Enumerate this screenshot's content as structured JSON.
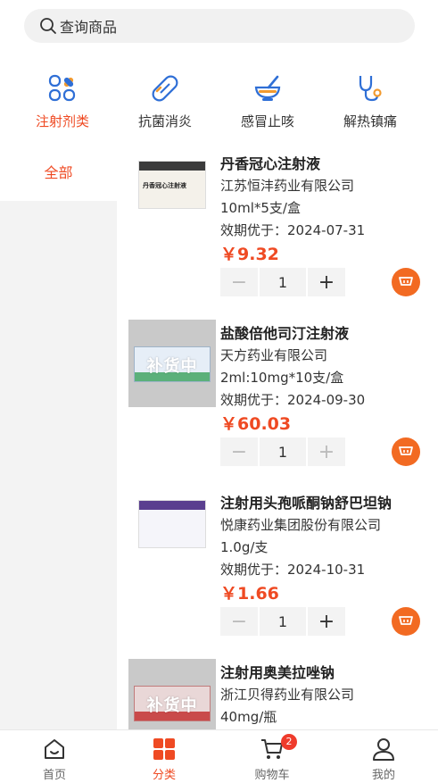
{
  "search": {
    "placeholder": "查询商品"
  },
  "categories": [
    {
      "label": "注射剂类",
      "icon": "vials-grid-icon",
      "active": true
    },
    {
      "label": "抗菌消炎",
      "icon": "capsule-icon",
      "active": false
    },
    {
      "label": "感冒止咳",
      "icon": "mortar-pestle-icon",
      "active": false
    },
    {
      "label": "解热镇痛",
      "icon": "stethoscope-icon",
      "active": false
    }
  ],
  "side_menu": {
    "items": [
      {
        "label": "全部",
        "active": true
      }
    ]
  },
  "products": [
    {
      "name": "丹香冠心注射液",
      "maker": "江苏恒沣药业有限公司",
      "spec": "10ml*5支/盒",
      "expiry": "效期优于：2024-07-31",
      "price": "￥9.32",
      "qty": "1",
      "restock": false,
      "restock_label": "",
      "box_text": "丹香冠心注射液"
    },
    {
      "name": "盐酸倍他司汀注射液",
      "maker": "天方药业有限公司",
      "spec": "2ml:10mg*10支/盒",
      "expiry": "效期优于：2024-09-30",
      "price": "￥60.03",
      "qty": "1",
      "restock": true,
      "restock_label": "补货中"
    },
    {
      "name": "注射用头孢哌酮钠舒巴坦钠",
      "maker": "悦康药业集团股份有限公司",
      "spec": "1.0g/支",
      "expiry": "效期优于：2024-10-31",
      "price": "￥1.66",
      "qty": "1",
      "restock": false,
      "restock_label": ""
    },
    {
      "name": "注射用奥美拉唑钠",
      "maker": "浙江贝得药业有限公司",
      "spec": "40mg/瓶",
      "restock": true,
      "restock_label": "补货中"
    }
  ],
  "stepper": {
    "minus": "−",
    "plus": "+"
  },
  "tabbar": {
    "items": [
      {
        "label": "首页",
        "icon": "home-icon",
        "active": false
      },
      {
        "label": "分类",
        "icon": "category-icon",
        "active": true
      },
      {
        "label": "购物车",
        "icon": "cart-icon",
        "active": false,
        "badge": "2"
      },
      {
        "label": "我的",
        "icon": "user-icon",
        "active": false
      }
    ]
  },
  "colors": {
    "accent": "#ef4a23",
    "icon_blue": "#2f6fd6",
    "cart_orange": "#f26a22"
  }
}
